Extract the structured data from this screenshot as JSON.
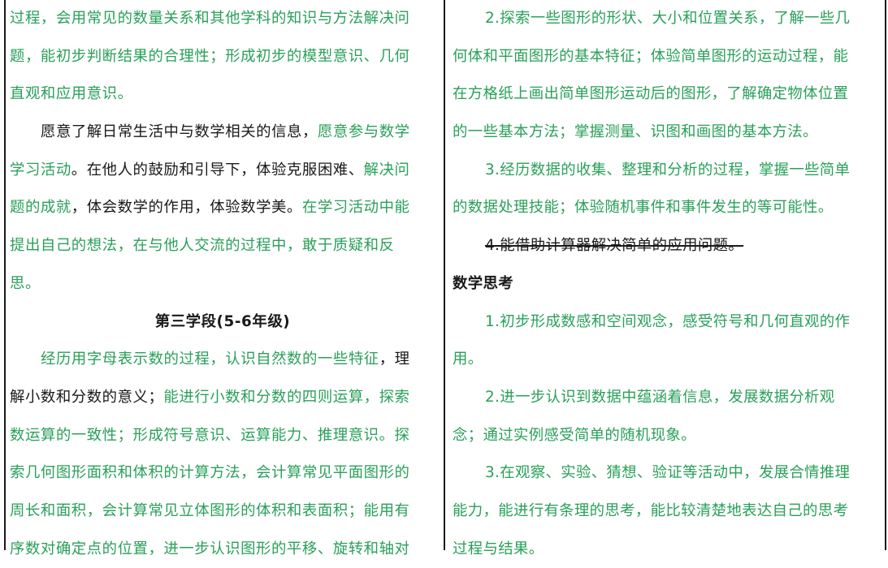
{
  "document": {
    "left_column": [
      {
        "indent": 0,
        "align": "left",
        "parts": [
          {
            "text": "过程，会用常见的数量关系和其他学科的知识与方法解决问",
            "color": "green"
          }
        ]
      },
      {
        "indent": 0,
        "align": "left",
        "parts": [
          {
            "text": "题，能初步判断结果的合理性；形成初步的模型意识、几何",
            "color": "green"
          }
        ]
      },
      {
        "indent": 0,
        "align": "left",
        "parts": [
          {
            "text": "直观和应用意识。",
            "color": "green"
          }
        ]
      },
      {
        "indent": 38,
        "align": "left",
        "parts": [
          {
            "text": "愿意了解日常生活中与数学相关的信息，",
            "color": "black"
          },
          {
            "text": "愿意参与数学",
            "color": "green"
          }
        ]
      },
      {
        "indent": 0,
        "align": "left",
        "parts": [
          {
            "text": "学习活动",
            "color": "green"
          },
          {
            "text": "。在他人的鼓励和引导下，体验克服困难、",
            "color": "black"
          },
          {
            "text": "解决问",
            "color": "green"
          }
        ]
      },
      {
        "indent": 0,
        "align": "left",
        "parts": [
          {
            "text": "题的成就",
            "color": "green"
          },
          {
            "text": "，体会数学的作用，体验数学美。",
            "color": "black"
          },
          {
            "text": "在学习活动中能",
            "color": "green"
          }
        ]
      },
      {
        "indent": 0,
        "align": "left",
        "parts": [
          {
            "text": "提出自己的想法，在与他人交流的过程中，敢于质疑和反",
            "color": "green"
          }
        ]
      },
      {
        "indent": 0,
        "align": "left",
        "parts": [
          {
            "text": "思。",
            "color": "green"
          }
        ]
      },
      {
        "indent": 0,
        "align": "center",
        "bold": true,
        "parts": [
          {
            "text": "第三学段(5-6年级)",
            "color": "black"
          }
        ]
      },
      {
        "indent": 38,
        "align": "left",
        "parts": [
          {
            "text": "经历用字母表示数的过程，认识自然数的一些特征",
            "color": "green"
          },
          {
            "text": "，理",
            "color": "black"
          }
        ]
      },
      {
        "indent": 0,
        "align": "left",
        "parts": [
          {
            "text": "解小数和分数的意义；",
            "color": "black"
          },
          {
            "text": "能进行小数和分数的四则运算，探索",
            "color": "green"
          }
        ]
      },
      {
        "indent": 0,
        "align": "left",
        "parts": [
          {
            "text": "数运算的一致性；形成符号意识、运算能力、推理意识。探",
            "color": "green"
          }
        ]
      },
      {
        "indent": 0,
        "align": "left",
        "parts": [
          {
            "text": "索几何图形面积和体积的计算方法，会计算常见平面图形的",
            "color": "green"
          }
        ]
      },
      {
        "indent": 0,
        "align": "left",
        "parts": [
          {
            "text": "周长和面积，会计算常见立体图形的体积和表面积；能用有",
            "color": "green"
          }
        ]
      },
      {
        "indent": 0,
        "align": "left",
        "parts": [
          {
            "text": "序数对确定点的位置，进一步认识图形的平移、旋转和轴对",
            "color": "green"
          }
        ]
      }
    ],
    "right_column": [
      {
        "indent": 40,
        "align": "left",
        "parts": [
          {
            "text": "2.探索一些图形的形状、大小和位置关系，了解一些几",
            "color": "green"
          }
        ]
      },
      {
        "indent": 0,
        "align": "left",
        "parts": [
          {
            "text": "何体和平面图形的基本特征；体验简单图形的运动过程，能",
            "color": "green"
          }
        ]
      },
      {
        "indent": 0,
        "align": "left",
        "parts": [
          {
            "text": "在方格纸上画出简单图形运动后的图形，了解确定物体位置",
            "color": "green"
          }
        ]
      },
      {
        "indent": 0,
        "align": "left",
        "parts": [
          {
            "text": "的一些基本方法；掌握测量、识图和画图的基本方法。",
            "color": "green"
          }
        ]
      },
      {
        "indent": 40,
        "align": "left",
        "parts": [
          {
            "text": "3.经历数据的收集、整理和分析的过程，掌握一些简单",
            "color": "green"
          }
        ]
      },
      {
        "indent": 0,
        "align": "left",
        "parts": [
          {
            "text": "的数据处理技能；体验随机事件和事件发生的等可能性。",
            "color": "green"
          }
        ]
      },
      {
        "indent": 40,
        "align": "left",
        "strike": true,
        "parts": [
          {
            "text": "4.能借助计算器解决简单的应用问题。",
            "color": "black"
          }
        ]
      },
      {
        "indent": 0,
        "align": "left",
        "bold": true,
        "parts": [
          {
            "text": "数学思考",
            "color": "black"
          }
        ]
      },
      {
        "indent": 40,
        "align": "left",
        "parts": [
          {
            "text": "1.初步形成数感和空间观念，感受符号和几何直观的作",
            "color": "green"
          }
        ]
      },
      {
        "indent": 0,
        "align": "left",
        "parts": [
          {
            "text": "用。",
            "color": "green"
          }
        ]
      },
      {
        "indent": 40,
        "align": "left",
        "parts": [
          {
            "text": "2.进一步认识到数据中蕴涵着信息，发展数据分析观",
            "color": "green"
          }
        ]
      },
      {
        "indent": 0,
        "align": "left",
        "parts": [
          {
            "text": "念；通过实例感受简单的随机现象。",
            "color": "green"
          }
        ]
      },
      {
        "indent": 40,
        "align": "left",
        "parts": [
          {
            "text": "3.在观察、实验、猜想、验证等活动中，发展合情推理",
            "color": "green"
          }
        ]
      },
      {
        "indent": 0,
        "align": "left",
        "parts": [
          {
            "text": "能力，能进行有条理的思考，能比较清楚地表达自己的思考",
            "color": "green"
          }
        ]
      },
      {
        "indent": 0,
        "align": "left",
        "parts": [
          {
            "text": "过程与结果。",
            "color": "green"
          }
        ]
      }
    ]
  },
  "colors": {
    "green": "#2aa05a",
    "black": "#1a1a1a",
    "border": "#1a1a1a"
  }
}
